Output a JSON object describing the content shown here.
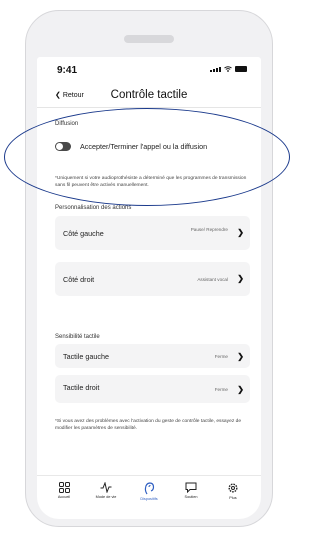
{
  "status_bar": {
    "time": "9:41"
  },
  "nav": {
    "back_label": "Retour",
    "title": "Contrôle tactile"
  },
  "diffusion": {
    "section_label": "Diffusion",
    "toggle_label": "Accepter/Terminer l'appel ou la diffusion",
    "toggle_on": false,
    "note": "*Uniquement si votre audioprothésiste a déterminé que les programmes de transmission sans fil peuvent être activés manuellement."
  },
  "actions": {
    "section_label": "Personnalisation des actions",
    "items": [
      {
        "label": "Côté gauche",
        "value": "Pause/ Reprendre"
      },
      {
        "label": "Côté droit",
        "value": "Assistant vocal"
      }
    ]
  },
  "sensitivity": {
    "section_label": "Sensibilité tactile",
    "items": [
      {
        "label": "Tactile gauche",
        "value": "Ferme"
      },
      {
        "label": "Tactile droit",
        "value": "Ferme"
      }
    ],
    "note": "*Si vous avez des problèmes avec l'activation du geste de contrôle tactile, essayez de modifier les paramètres de sensibilité."
  },
  "tabbar": {
    "tabs": [
      {
        "label": "Accueil",
        "icon": "grid-icon",
        "active": false
      },
      {
        "label": "Mode de vie",
        "icon": "pulse-icon",
        "active": false
      },
      {
        "label": "Dispositifs",
        "icon": "hearing-aid-icon",
        "active": true
      },
      {
        "label": "Soutien",
        "icon": "chat-icon",
        "active": false
      },
      {
        "label": "Plus",
        "icon": "gear-icon",
        "active": false
      }
    ]
  },
  "colors": {
    "accent": "#2f5fc2",
    "annotation": "#1b3a8c",
    "card_bg": "#f4f4f5"
  }
}
